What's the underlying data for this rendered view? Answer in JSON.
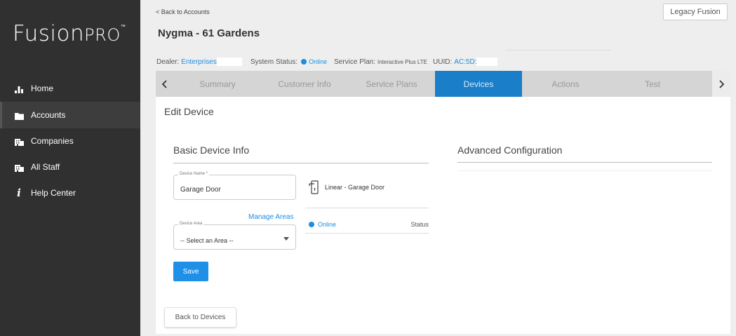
{
  "logo": {
    "text_main": "Fusion",
    "text_pro": "PRO",
    "tm": "™"
  },
  "sidebar": {
    "items": [
      {
        "label": "Home",
        "icon": "bar-chart-icon"
      },
      {
        "label": "Accounts",
        "icon": "folder-icon"
      },
      {
        "label": "Companies",
        "icon": "building-icon"
      },
      {
        "label": "All Staff",
        "icon": "building-icon"
      },
      {
        "label": "Help Center",
        "icon": "info-icon"
      }
    ],
    "active": "Accounts"
  },
  "header": {
    "back_link": "< Back to Accounts",
    "legacy_button": "Legacy Fusion",
    "account_title": "Nygma - 61 Gardens"
  },
  "info": {
    "dealer_label": "Dealer:",
    "dealer_value": "Enterprises",
    "system_status_label": "System Status:",
    "system_status_value": "Online",
    "service_plan_label": "Service Plan:",
    "service_plan_value": "Interactive Plus LTE",
    "uuid_label": "UUID:",
    "uuid_value": "AC:5D:"
  },
  "tabs": {
    "prev": "‹",
    "next": "›",
    "items": [
      "Summary",
      "Customer Info",
      "Service Plans",
      "Devices",
      "Actions",
      "Test"
    ],
    "active": "Devices"
  },
  "card": {
    "title": "Edit Device",
    "basic_section": "Basic Device Info",
    "advanced_section": "Advanced Configuration",
    "device_name_label": "Device Name *",
    "device_name_value": "Garage Door",
    "device_type": "Linear - Garage Door",
    "manage_areas": "Manage Areas",
    "device_area_label": "Device Area",
    "device_area_value": "-- Select an Area --",
    "status_value": "Online",
    "status_label": "Status",
    "save_button": "Save",
    "back_button": "Back to Devices"
  },
  "colors": {
    "sidebar_bg": "#303030",
    "accent": "#1a8fe3",
    "active_tab": "#1a7ec8",
    "page_bg": "#eeeeee"
  }
}
